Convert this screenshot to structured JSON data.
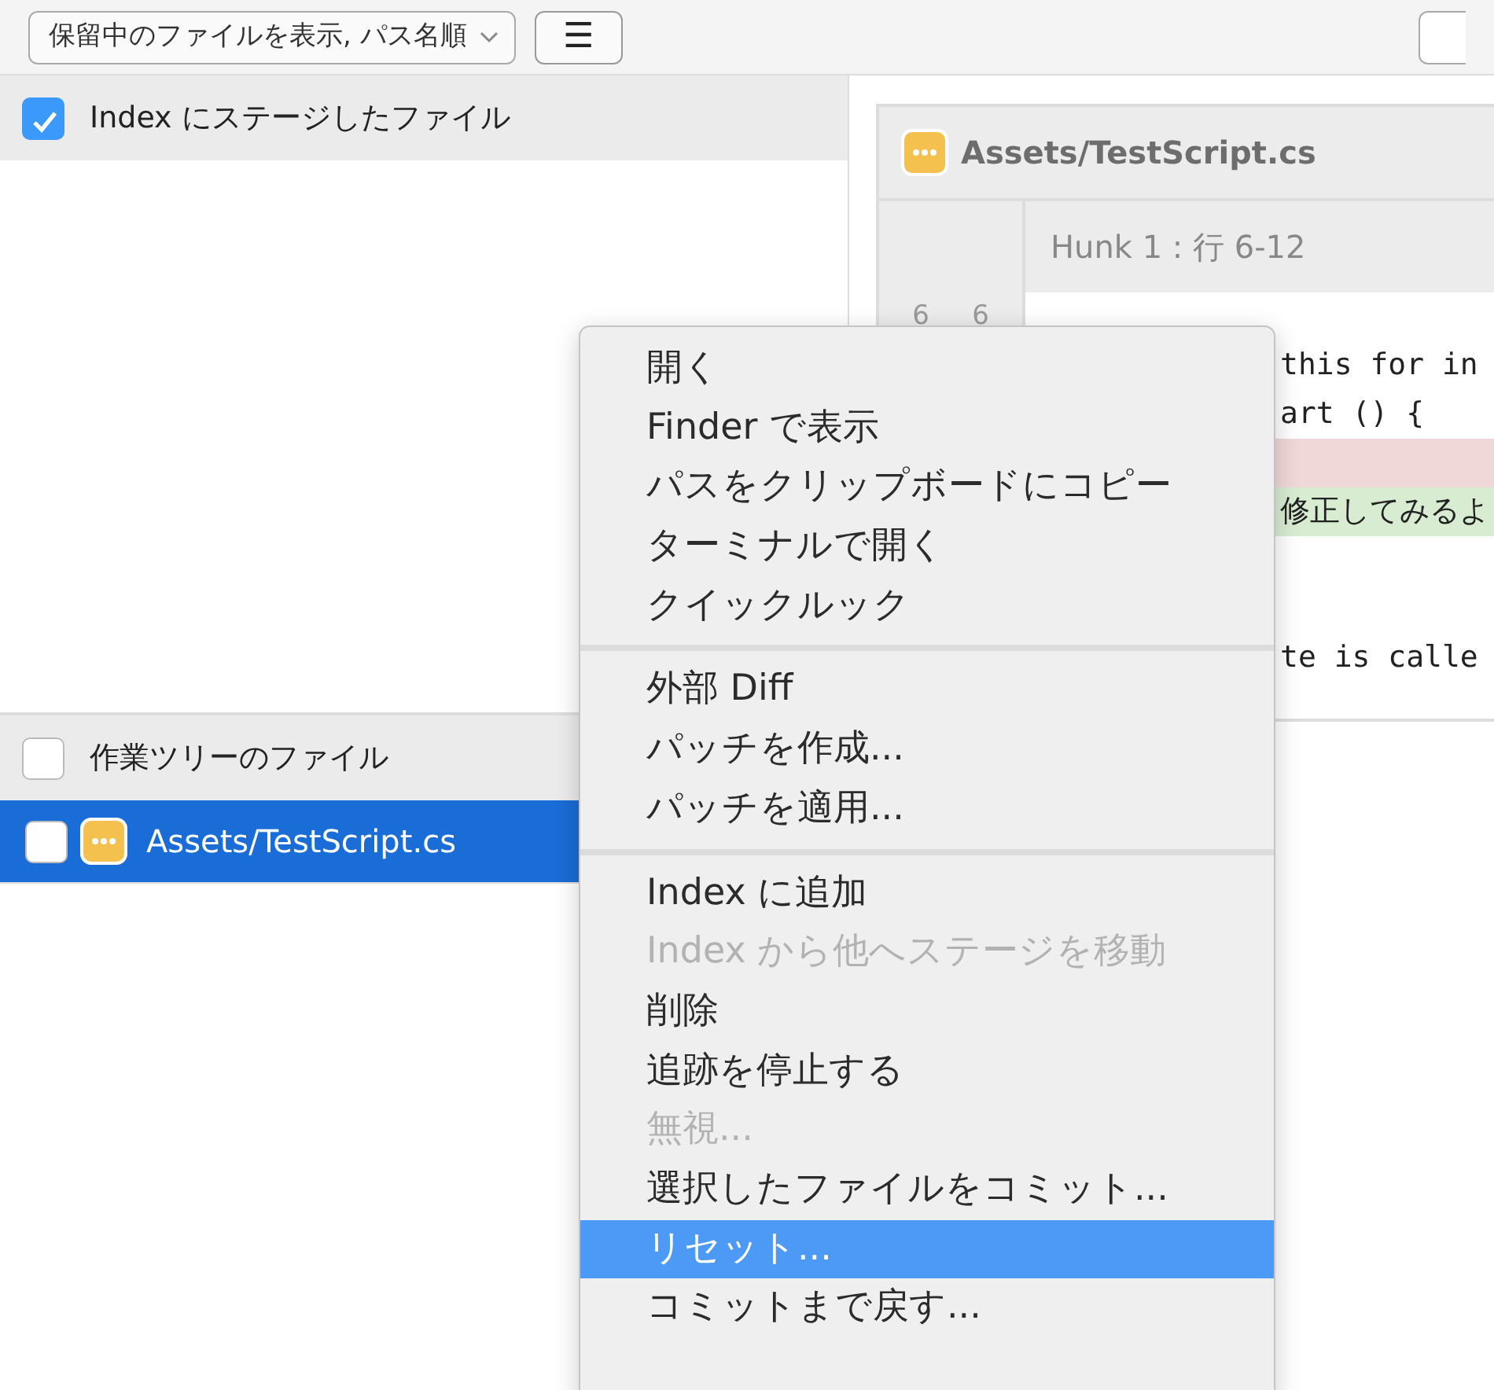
{
  "toolbar": {
    "view_dropdown": "保留中のファイルを表示, パス名順",
    "menu_button": "☰"
  },
  "staged_section": {
    "label": "Index にステージしたファイル",
    "checked": true
  },
  "working_section": {
    "label": "作業ツリーのファイル",
    "checked": false,
    "files": [
      {
        "name": "Assets/TestScript.cs",
        "checked": false,
        "selected": true
      }
    ]
  },
  "diff": {
    "file": "Assets/TestScript.cs",
    "hunk_header": "Hunk 1 : 行 6-12",
    "line_numbers": [
      {
        "old": "6",
        "new": "6"
      }
    ],
    "lines": [
      {
        "kind": "context"
      },
      {
        "kind": "context",
        "text": "this for in"
      },
      {
        "kind": "context",
        "text": "art () {"
      },
      {
        "kind": "removed"
      },
      {
        "kind": "added",
        "text": "修正してみるよ"
      },
      {
        "kind": "context"
      },
      {
        "kind": "context"
      },
      {
        "kind": "context",
        "text": "te is calle"
      },
      {
        "kind": "context"
      }
    ]
  },
  "context_menu": {
    "groups": [
      [
        {
          "label": "開く",
          "disabled": false,
          "selected": false
        },
        {
          "label": "Finder で表示",
          "disabled": false,
          "selected": false
        },
        {
          "label": "パスをクリップボードにコピー",
          "disabled": false,
          "selected": false
        },
        {
          "label": "ターミナルで開く",
          "disabled": false,
          "selected": false
        },
        {
          "label": "クイックルック",
          "disabled": false,
          "selected": false
        }
      ],
      [
        {
          "label": "外部 Diff",
          "disabled": false,
          "selected": false
        },
        {
          "label": "パッチを作成...",
          "disabled": false,
          "selected": false
        },
        {
          "label": "パッチを適用...",
          "disabled": false,
          "selected": false
        }
      ],
      [
        {
          "label": "Index に追加",
          "disabled": false,
          "selected": false
        },
        {
          "label": "Index から他へステージを移動",
          "disabled": true,
          "selected": false
        },
        {
          "label": "削除",
          "disabled": false,
          "selected": false
        },
        {
          "label": "追跡を停止する",
          "disabled": false,
          "selected": false
        },
        {
          "label": "無視...",
          "disabled": true,
          "selected": false
        },
        {
          "label": "選択したファイルをコミット...",
          "disabled": false,
          "selected": false
        },
        {
          "label": "リセット...",
          "disabled": false,
          "selected": true
        },
        {
          "label": "コミットまで戻す...",
          "disabled": false,
          "selected": false
        }
      ]
    ]
  }
}
